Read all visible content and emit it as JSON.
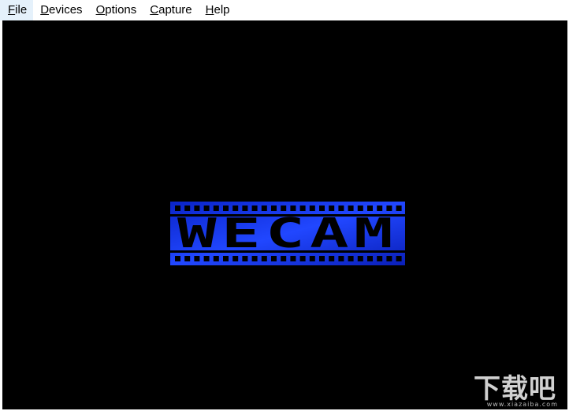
{
  "menubar": {
    "items": [
      {
        "label": "File",
        "mnemonic": "F",
        "rest": "ile"
      },
      {
        "label": "Devices",
        "mnemonic": "D",
        "rest": "evices"
      },
      {
        "label": "Options",
        "mnemonic": "O",
        "rest": "ptions"
      },
      {
        "label": "Capture",
        "mnemonic": "C",
        "rest": "apture"
      },
      {
        "label": "Help",
        "mnemonic": "H",
        "rest": "elp"
      }
    ]
  },
  "preview": {
    "logo_text": "WECAM",
    "logo_color": "#1a3dff",
    "background": "#000000"
  },
  "watermark": {
    "text": "下载吧",
    "url": "www.xiazaiba.com"
  }
}
